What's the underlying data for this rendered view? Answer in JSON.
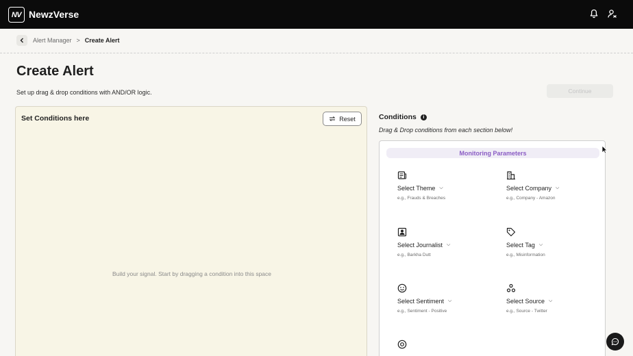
{
  "app": {
    "logo": "NV",
    "title": "NewzVerse"
  },
  "topbar_icons": [
    "bell-icon",
    "user-switch-icon"
  ],
  "breadcrumb": {
    "parent": "Alert Manager",
    "separator": ">",
    "current": "Create Alert"
  },
  "page": {
    "title": "Create Alert",
    "subtitle": "Set up drag & drop conditions with AND/OR logic.",
    "continue_label": "Continue"
  },
  "drop_zone": {
    "title": "Set Conditions here",
    "reset_label": "Reset",
    "hint": "Build your signal. Start by dragging a condition into this space"
  },
  "conditions": {
    "title": "Conditions",
    "info": "i",
    "subtitle": "Drag & Drop conditions from each section below!",
    "section_header": "Monitoring Parameters",
    "items": [
      {
        "label": "Select Theme",
        "example": "e.g., Frauds & Breaches",
        "icon": "theme-icon"
      },
      {
        "label": "Select Company",
        "example": "e.g., Company - Amazon",
        "icon": "company-icon"
      },
      {
        "label": "Select Journalist",
        "example": "e.g., Barkha Dutt",
        "icon": "journalist-icon"
      },
      {
        "label": "Select Tag",
        "example": "e.g., Misinformation",
        "icon": "tag-icon"
      },
      {
        "label": "Select Sentiment",
        "example": "e.g., Sentiment - Positive",
        "icon": "sentiment-icon"
      },
      {
        "label": "Select Source",
        "example": "e.g., Source - Twitter",
        "icon": "source-icon"
      },
      {
        "label": "",
        "example": "",
        "icon": "mention-icon"
      }
    ]
  },
  "colors": {
    "topbar": "#0b0b0b",
    "accent_purple": "#8a5cc4",
    "drop_zone_bg": "#f8f5e6"
  }
}
